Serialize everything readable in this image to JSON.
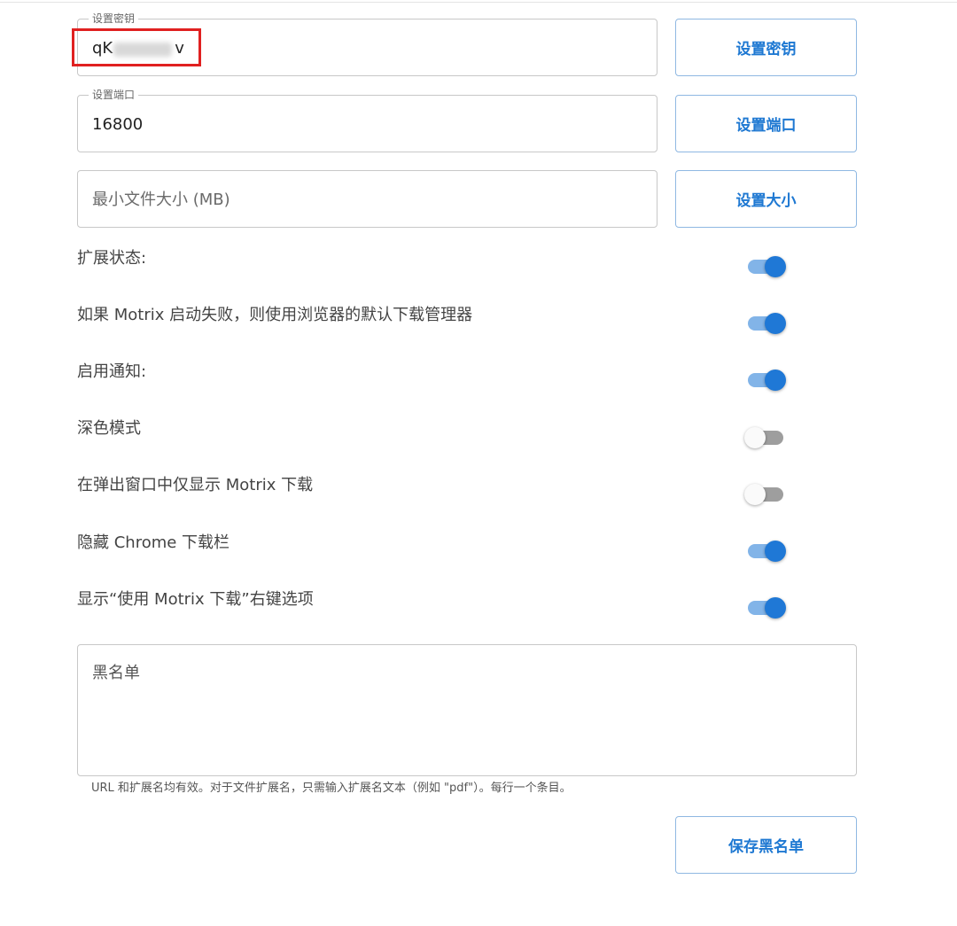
{
  "fields": {
    "secret": {
      "legend": "设置密钥",
      "value": "qK",
      "value_tail": "v"
    },
    "port": {
      "legend": "设置端口",
      "value": "16800"
    },
    "min_size": {
      "placeholder": "最小文件大小 (MB)"
    }
  },
  "buttons": {
    "set_secret": "设置密钥",
    "set_port": "设置端口",
    "set_size": "设置大小",
    "save_blacklist": "保存黑名单"
  },
  "toggles": [
    {
      "label": "扩展状态:",
      "on": true
    },
    {
      "label": "如果 Motrix 启动失败，则使用浏览器的默认下载管理器",
      "on": true
    },
    {
      "label": "启用通知:",
      "on": true
    },
    {
      "label": "深色模式",
      "on": false
    },
    {
      "label": "在弹出窗口中仅显示 Motrix 下载",
      "on": false
    },
    {
      "label": "隐藏 Chrome 下载栏",
      "on": true
    },
    {
      "label": "显示“使用 Motrix 下载”右键选项",
      "on": true
    }
  ],
  "blacklist": {
    "placeholder": "黑名单",
    "hint": "URL 和扩展名均有效。对于文件扩展名，只需输入扩展名文本（例如 \"pdf\"）。每行一个条目。"
  },
  "colors": {
    "accent": "#1f78d6",
    "track_on": "#82b4e8",
    "track_off": "#9e9e9e",
    "highlight": "#e02020"
  }
}
